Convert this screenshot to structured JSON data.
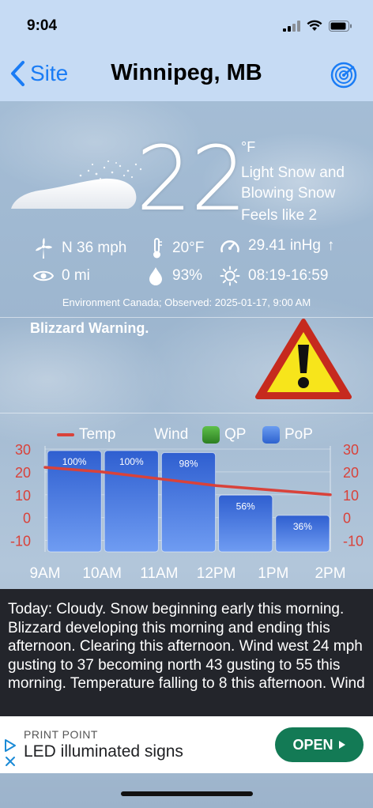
{
  "status_bar": {
    "time": "9:04"
  },
  "nav": {
    "back_label": "Site",
    "title": "Winnipeg, MB"
  },
  "current": {
    "temperature": "22",
    "unit": "°F",
    "condition": "Light Snow and Blowing Snow",
    "feels_like": "Feels like 2",
    "wind": "N 36 mph",
    "dewpoint": "20°F",
    "pressure": "29.41 inHg",
    "pressure_trend": "↑",
    "visibility": "0 mi",
    "humidity": "93%",
    "sunrise_sunset": "08:19-16:59",
    "observed": "Environment Canada; Observed: 2025-01-17, 9:00 AM"
  },
  "warning": {
    "text": "Blizzard Warning."
  },
  "legend": {
    "temp": "Temp",
    "wind": "Wind",
    "qp": "QP",
    "pop": "PoP"
  },
  "colors": {
    "temp_line": "#d9423a",
    "pop_bar": "#3a74e0",
    "qp": "#3a9a2a",
    "axis_label": "#d9423a",
    "warning_yellow": "#f7e51b"
  },
  "chart_data": {
    "type": "bar",
    "categories": [
      "9AM",
      "10AM",
      "11AM",
      "12PM",
      "1PM",
      "2PM"
    ],
    "ylim": [
      -15,
      30
    ],
    "y_ticks": [
      "30",
      "20",
      "10",
      "0",
      "-10"
    ],
    "series": [
      {
        "name": "PoP",
        "unit": "%",
        "values": [
          100,
          100,
          98,
          56,
          36
        ],
        "labels": [
          "100%",
          "100%",
          "98%",
          "56%",
          "36%"
        ]
      },
      {
        "name": "Temp",
        "values": [
          22,
          20,
          17,
          14,
          12,
          10
        ]
      }
    ]
  },
  "forecast": {
    "text": "Today:  Cloudy. Snow beginning early this morning. Blizzard developing this morning and ending this afternoon. Clearing this afternoon. Wind west 24 mph gusting to 37 becoming north 43 gusting to 55 this morning. Temperature falling to 8 this afternoon. Wind"
  },
  "ad": {
    "brand": "PRINT POINT",
    "title": "LED illuminated signs",
    "button": "OPEN"
  }
}
